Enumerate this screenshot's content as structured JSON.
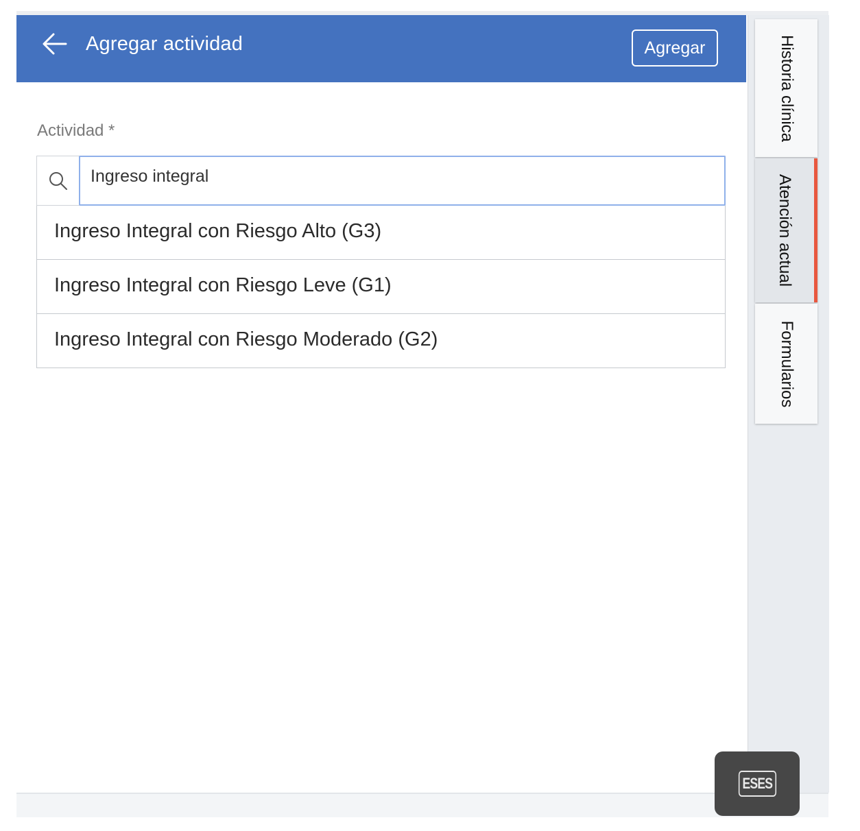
{
  "header": {
    "title": "Agregar actividad",
    "add_label": "Agregar",
    "back_icon": "arrow-left-icon",
    "color": "#4472bf"
  },
  "form": {
    "field_label": "Actividad *",
    "search_value": "Ingreso integral",
    "search_icon": "search-icon",
    "options": [
      "Ingreso Integral con Riesgo Alto (G3)",
      "Ingreso Integral con Riesgo Leve (G1)",
      "Ingreso Integral con Riesgo Moderado (G2)"
    ]
  },
  "side_tabs": [
    {
      "label": "Historia clínica",
      "active": false
    },
    {
      "label": "Atención actual",
      "active": true
    },
    {
      "label": "Formularios",
      "active": false
    }
  ],
  "active_tab_color": "#e8573f",
  "fab": {
    "label": "ESES"
  }
}
